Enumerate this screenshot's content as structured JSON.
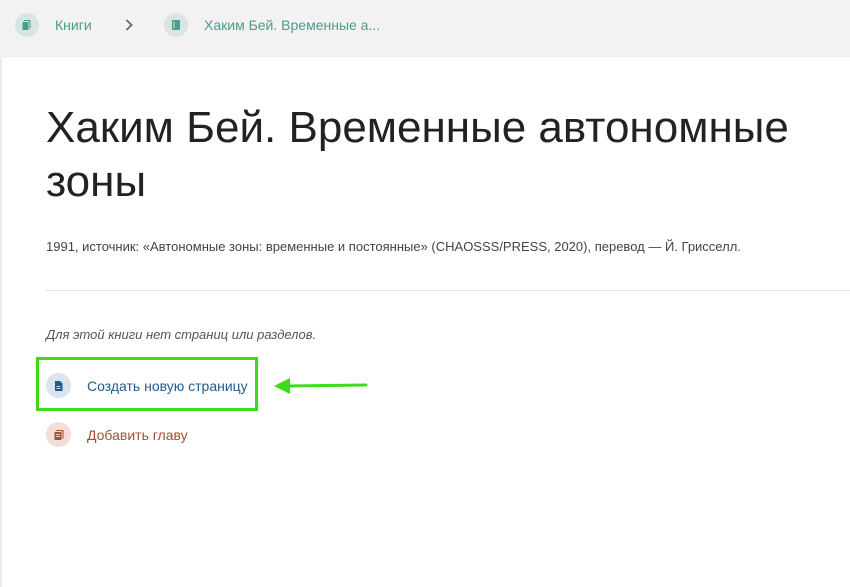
{
  "breadcrumb": {
    "books_label": "Книги",
    "book_label": "Хаким Бей. Временные а...",
    "books_icon": "books-icon",
    "book_icon": "book-icon",
    "separator_icon": "chevron-right-icon"
  },
  "book": {
    "title": "Хаким Бей. Временные автономные зоны",
    "description": "1991, источник: «Автономные зоны: временные и постоянные» (CHAOSSS/PRESS, 2020), перевод — Й. Грисселл.",
    "empty_note": "Для этой книги нет страниц или разделов."
  },
  "actions": {
    "create_page_label": "Создать новую страницу",
    "create_page_icon": "page-icon",
    "add_chapter_label": "Добавить главу",
    "add_chapter_icon": "chapter-icon"
  },
  "annotation": {
    "highlight_color": "#3ddc1a",
    "arrow_icon": "arrow-left-icon"
  },
  "colors": {
    "breadcrumb_link": "#4d9b8b",
    "page_action": "#1f5b8f",
    "chapter_action": "#a0522d"
  }
}
